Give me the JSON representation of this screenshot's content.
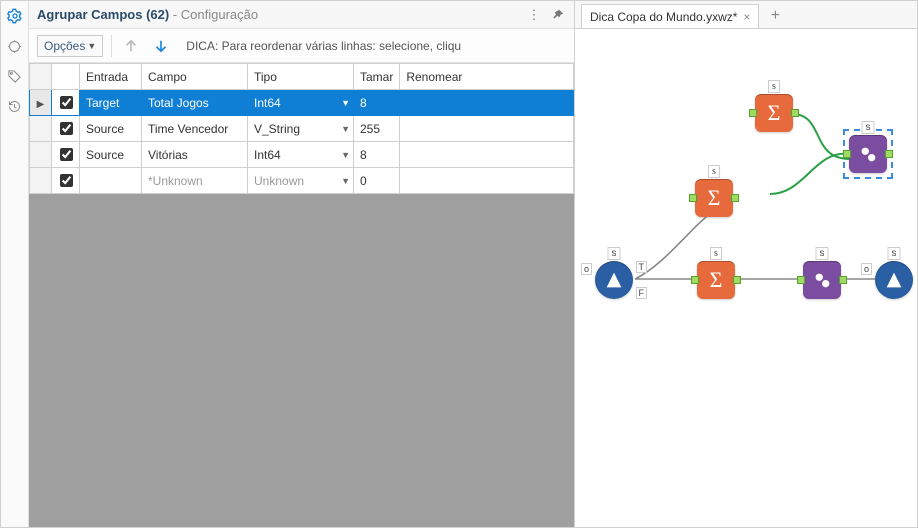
{
  "panel": {
    "title": "Agrupar Campos (62)",
    "subtitle": " - Configuração"
  },
  "toolbar": {
    "opcoes": "Opções",
    "hint": "DICA: Para reordenar várias linhas: selecione, cliqu"
  },
  "grid": {
    "headers": {
      "entrada": "Entrada",
      "campo": "Campo",
      "tipo": "Tipo",
      "tamanho": "Tamar",
      "renomear": "Renomear"
    },
    "rows": [
      {
        "sel": true,
        "chk": true,
        "entrada": "Target",
        "campo": "Total Jogos",
        "tipo": "Int64",
        "tam": "8",
        "ren": ""
      },
      {
        "sel": false,
        "chk": true,
        "entrada": "Source",
        "campo": "Time Vencedor",
        "tipo": "V_String",
        "tam": "255",
        "ren": ""
      },
      {
        "sel": false,
        "chk": true,
        "entrada": "Source",
        "campo": "Vitórias",
        "tipo": "Int64",
        "tam": "8",
        "ren": ""
      },
      {
        "sel": false,
        "chk": true,
        "unk": true,
        "entrada": "",
        "campo": "*Unknown",
        "tipo": "Unknown",
        "tam": "0",
        "ren": ""
      }
    ]
  },
  "tabs": {
    "active": "Dica Copa do Mundo.yxwz*"
  },
  "tools": {
    "sigma": "Σ",
    "s_label": "s",
    "o_label": "o",
    "t_label": "T",
    "f_label": "F"
  }
}
